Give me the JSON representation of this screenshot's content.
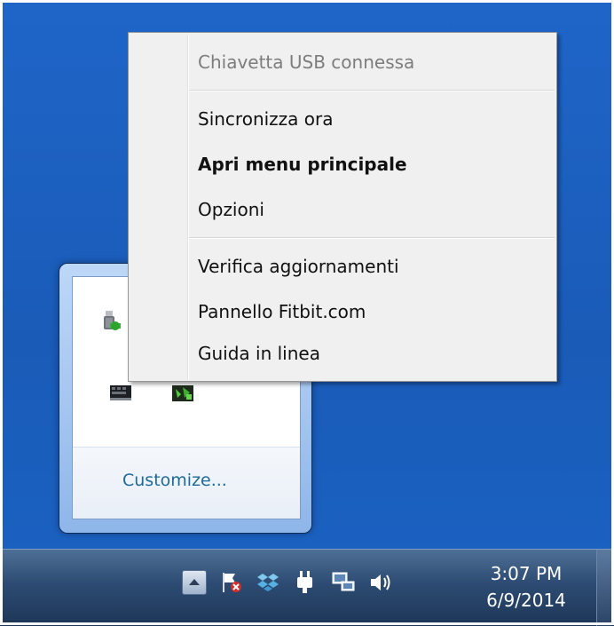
{
  "context_menu": {
    "header": "Chiavetta USB connessa",
    "items": [
      {
        "label": "Sincronizza ora"
      },
      {
        "label": "Apri menu principale"
      },
      {
        "label": "Opzioni"
      },
      {
        "label": "Verifica aggiornamenti"
      },
      {
        "label": "Pannello Fitbit.com"
      },
      {
        "label": "Guida in linea"
      }
    ]
  },
  "tray_flyout": {
    "customize_label": "Customize...",
    "icons": [
      "usb-dongle-icon",
      "keyboard-device-icon",
      "green-device-icon"
    ]
  },
  "taskbar": {
    "show_hidden_icons": "chevron-up-icon",
    "tray_icons": [
      "action-center-flag-icon",
      "dropbox-icon",
      "power-plug-icon",
      "network-icon",
      "volume-icon"
    ],
    "clock": {
      "time": "3:07 PM",
      "date": "6/9/2014"
    }
  },
  "colors": {
    "desktop_blue": "#1f65c8",
    "menu_bg": "#f0f0f0",
    "customize_link": "#1f6a98",
    "taskbar": "#2d4b72"
  }
}
